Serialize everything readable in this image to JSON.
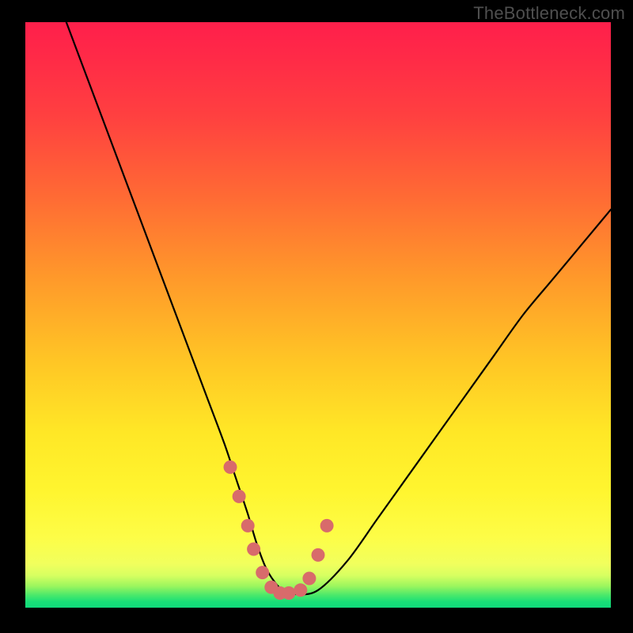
{
  "watermark": "TheBottleneck.com",
  "chart_data": {
    "type": "line",
    "title": "",
    "xlabel": "",
    "ylabel": "",
    "xlim": [
      0,
      100
    ],
    "ylim": [
      0,
      100
    ],
    "grid": false,
    "legend": false,
    "series": [
      {
        "name": "bottleneck-curve",
        "x": [
          7,
          10,
          13,
          16,
          19,
          22,
          25,
          28,
          31,
          34,
          36,
          38,
          39.5,
          41,
          42.5,
          44,
          46.5,
          50,
          55,
          60,
          65,
          70,
          75,
          80,
          85,
          90,
          95,
          100
        ],
        "y": [
          100,
          92,
          84,
          76,
          68,
          60,
          52,
          44,
          36,
          28,
          22,
          16,
          11,
          7,
          4.5,
          3,
          2.3,
          3,
          8,
          15,
          22,
          29,
          36,
          43,
          50,
          56,
          62,
          68
        ]
      }
    ],
    "markers": {
      "name": "highlighted-points",
      "color": "#d86b6b",
      "x": [
        35,
        36.5,
        38,
        39,
        40.5,
        42,
        43.5,
        45,
        47,
        48.5,
        50,
        51.5
      ],
      "y": [
        24,
        19,
        14,
        10,
        6,
        3.5,
        2.5,
        2.5,
        3,
        5,
        9,
        14
      ]
    },
    "background_gradient": {
      "top": "#ff1f4b",
      "mid_upper": "#ff9a2a",
      "mid_lower": "#fff52f",
      "bottom": "#10da7b"
    }
  }
}
